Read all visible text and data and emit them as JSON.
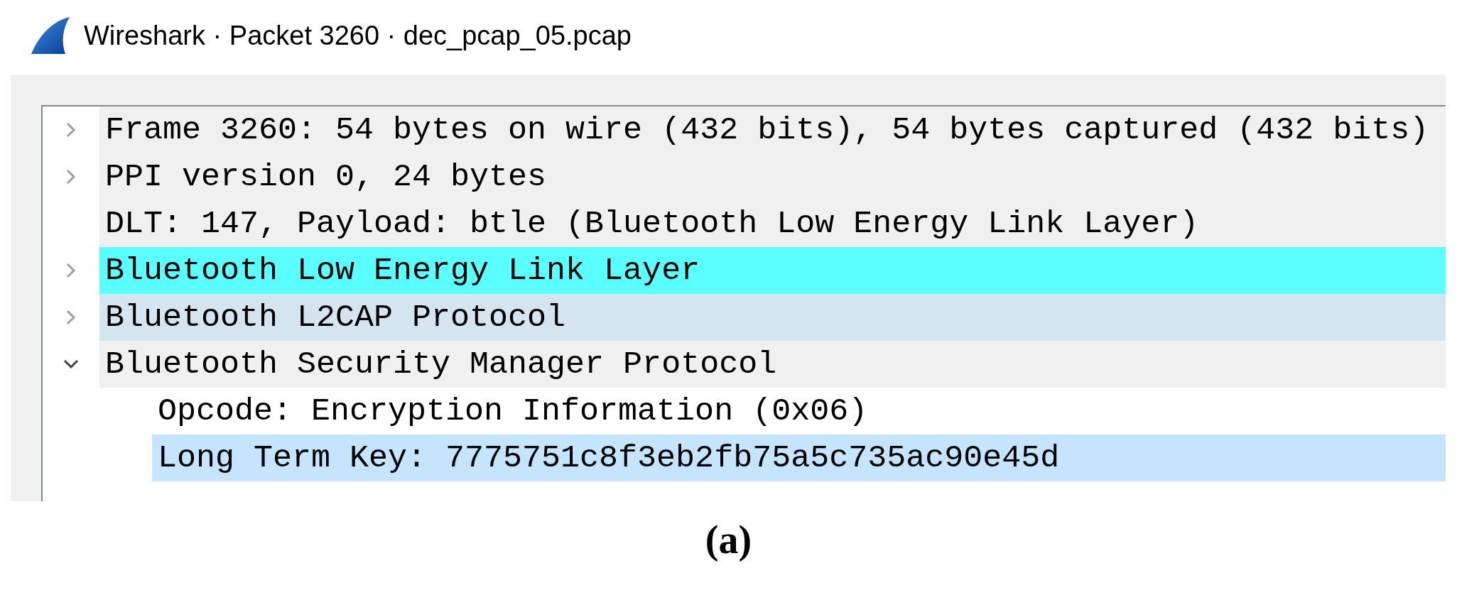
{
  "window": {
    "title": "Wireshark · Packet 3260 · dec_pcap_05.pcap"
  },
  "rows": [
    {
      "label": "Frame 3260: 54 bytes on wire (432 bits), 54 bytes captured (432 bits)",
      "kind": "branch",
      "expanded": false,
      "color": "#f0f0f0"
    },
    {
      "label": "PPI version 0, 24 bytes",
      "kind": "branch",
      "expanded": false,
      "color": "#f0f0f0"
    },
    {
      "label": "DLT: 147, Payload: btle (Bluetooth Low Energy Link Layer)",
      "kind": "leaf",
      "color": "#f0f0f0"
    },
    {
      "label": "Bluetooth Low Energy Link Layer",
      "kind": "branch",
      "expanded": false,
      "color": "#5affff"
    },
    {
      "label": "Bluetooth L2CAP Protocol",
      "kind": "branch",
      "expanded": false,
      "color": "#d4e5f0"
    },
    {
      "label": "Bluetooth Security Manager Protocol",
      "kind": "branch",
      "expanded": true,
      "color": "#f0f0f0",
      "children": [
        {
          "label": "Opcode: Encryption Information (0x06)",
          "color": "#ffffff"
        },
        {
          "label": "Long Term Key: 7775751c8f3eb2fb75a5c735ac90e45d",
          "color": "#c4e5fd"
        }
      ]
    }
  ],
  "caption": "(a)"
}
